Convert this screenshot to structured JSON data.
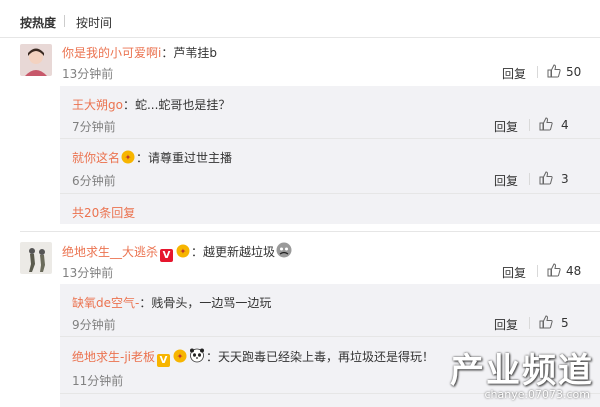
{
  "sort": {
    "hot": "按热度",
    "time": "按时间"
  },
  "colors": {
    "username": "#eb7350",
    "reply_bg": "#f2f2f5",
    "vip": "#e6162d"
  },
  "comments": [
    {
      "username": "你是我的小可爱啊i",
      "text": "：芦苇挂b",
      "time": "13分钟前",
      "reply_label": "回复",
      "likes": "50",
      "replies": [
        {
          "username": "王大朔go",
          "text": "：蛇...蛇哥也是挂？",
          "time": "7分钟前",
          "reply_label": "回复",
          "likes": "4"
        },
        {
          "username": "就你这名",
          "text": "：请尊重过世主播",
          "time": "6分钟前",
          "reply_label": "回复",
          "likes": "3"
        }
      ],
      "more_replies": "共20条回复"
    },
    {
      "username": "绝地求生__大逃杀",
      "text": "：越更新越垃圾",
      "time": "13分钟前",
      "reply_label": "回复",
      "likes": "48",
      "replies": [
        {
          "username": "缺氧de空气-",
          "text": "：贱骨头，一边骂一边玩",
          "time": "9分钟前",
          "reply_label": "回复",
          "likes": "5"
        },
        {
          "username": "绝地求生-ji老板",
          "text": "：天天跑毒已经染上毒，再垃圾还是得玩！",
          "time": "11分钟前",
          "reply_label": "回复",
          "likes": ""
        }
      ]
    }
  ],
  "watermark": {
    "title": "产业频道",
    "url": "chanye.07073.com"
  }
}
